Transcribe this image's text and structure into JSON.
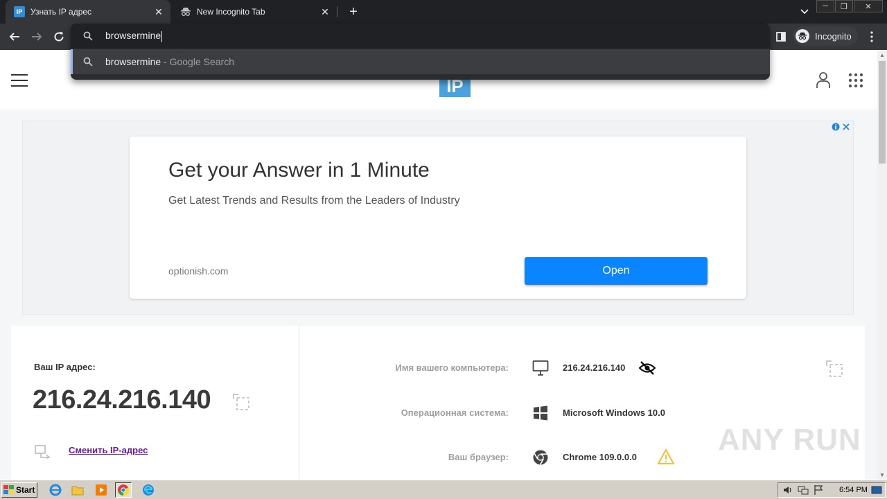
{
  "browser": {
    "tabs": [
      {
        "favicon": "IP",
        "title": "Узнать IP адрес"
      },
      {
        "favicon": "incognito-icon",
        "title": "New Incognito Tab"
      }
    ],
    "omnibox": {
      "input_value": "browsermine",
      "suggestion_query": "browsermine",
      "suggestion_suffix": " - Google Search"
    },
    "profile_label": "Incognito"
  },
  "site": {
    "logo_text": "IP",
    "ad": {
      "title": "Get your Answer in 1 Minute",
      "description": "Get Latest Trends and Results from the Leaders of Industry",
      "domain": "optionish.com",
      "button_label": "Open"
    },
    "ip_panel": {
      "label": "Ваш IP адрес:",
      "ip": "216.24.216.140",
      "change_link": "Сменить IP-адрес",
      "rows": [
        {
          "key": "Имя вашего компьютера:",
          "value": "216.24.216.140",
          "icon": "monitor-icon",
          "badge": "eye-slash-icon"
        },
        {
          "key": "Операционная система:",
          "value": "Microsoft Windows 10.0",
          "icon": "windows-icon"
        },
        {
          "key": "Ваш браузер:",
          "value": "Chrome 109.0.0.0",
          "icon": "chrome-icon",
          "badge": "warning-icon"
        }
      ]
    }
  },
  "watermark": "ANY RUN",
  "taskbar": {
    "start_label": "Start",
    "clock": "6:54 PM"
  },
  "colors": {
    "ad_button": "#0b84ff",
    "change_link": "#6a1b9a",
    "logo": "#4aa3df",
    "warning": "#f2c12e"
  }
}
